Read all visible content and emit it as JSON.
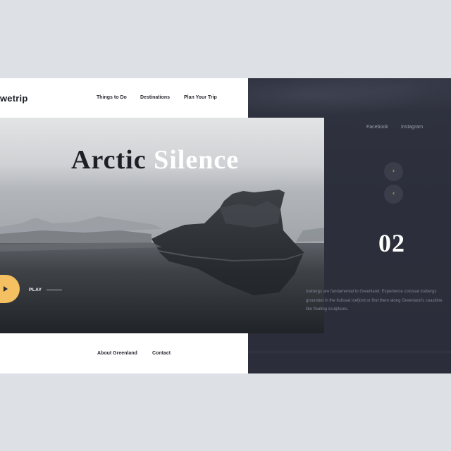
{
  "header": {
    "logo": "wetrip",
    "nav": [
      "Things to Do",
      "Destinations",
      "Plan Your Trip"
    ]
  },
  "social": [
    "Facebook",
    "Instagram"
  ],
  "hero": {
    "title_word1": "Arctic",
    "title_word2": "Silence"
  },
  "play": {
    "label": "PLAY"
  },
  "slider": {
    "next_icon": "chevron-right-icon",
    "prev_icon": "chevron-left-icon",
    "next_glyph": "›",
    "prev_glyph": "‹",
    "current": "02"
  },
  "description": "Icebergs are fundamental to Greenland. Experience colossal icebergs grounded in the Ilulissat Icefjord or find them along Greenland's coastline like floating sculptures.",
  "footer": {
    "links": [
      "About Greenland",
      "Contact"
    ]
  },
  "colors": {
    "background": "#dde1e6",
    "dark_panel": "#2c2f3b",
    "accent": "#f5c062",
    "arrow": "#f0b252"
  }
}
